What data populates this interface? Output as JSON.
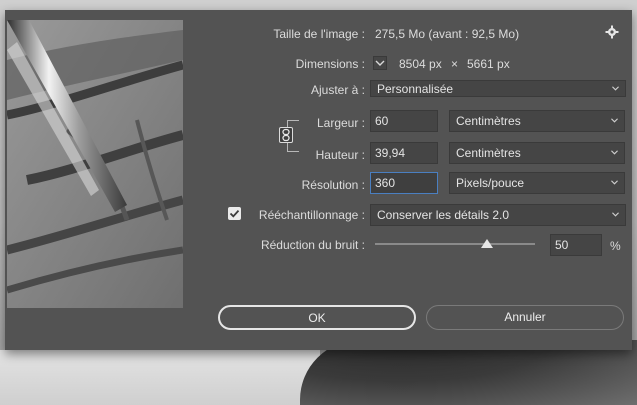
{
  "dialog": {
    "image_size_label": "Taille de l'image :",
    "image_size_value": "275,5 Mo (avant : 92,5 Mo)",
    "dimensions_label": "Dimensions :",
    "dimensions_width": "8504 px",
    "dimensions_times": "×",
    "dimensions_height": "5661 px",
    "fit_label": "Ajuster à :",
    "fit_value": "Personnalisée",
    "width_label": "Largeur :",
    "width_value": "60",
    "width_unit": "Centimètres",
    "height_label": "Hauteur :",
    "height_value": "39,94",
    "height_unit": "Centimètres",
    "resolution_label": "Résolution :",
    "resolution_value": "360",
    "resolution_unit": "Pixels/pouce",
    "resample_label": "Rééchantillonnage :",
    "resample_checked": true,
    "resample_value": "Conserver les détails 2.0",
    "noise_label": "Réduction du bruit :",
    "noise_value": "50",
    "noise_unit": "%",
    "noise_fraction": 0.5,
    "ok_label": "OK",
    "cancel_label": "Annuler"
  },
  "colors": {
    "dialog_bg": "#535353",
    "field_bg": "#454545",
    "focus_border": "#4a7fc1"
  }
}
